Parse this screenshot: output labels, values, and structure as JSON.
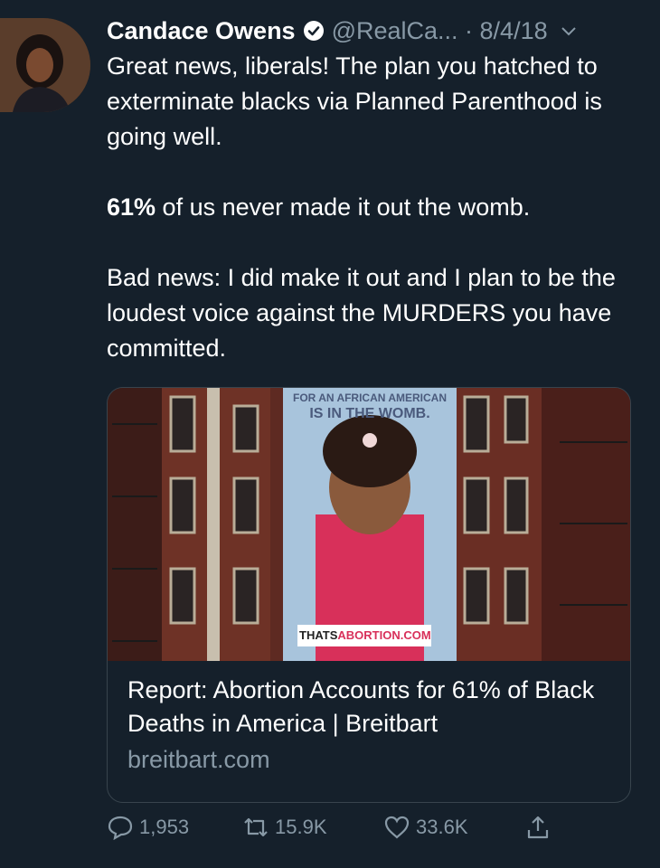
{
  "tweet": {
    "author_name": "Candace Owens",
    "handle_and_date": "@RealCa... · 8/4/18",
    "paragraphs": [
      "Great news, liberals! The plan you hatched to exterminate blacks via Planned Parenthood is going well.",
      "61% of us never made it out the womb.",
      "Bad news: I did make it out and I plan to be the loudest voice against the MURDERS you have committed."
    ],
    "para2_bold": "61%",
    "para2_rest": " of us never made it out the womb."
  },
  "card": {
    "billboard_line1": "FOR AN AFRICAN AMERICAN",
    "billboard_line2": "IS IN THE WOMB.",
    "billboard_site_a": "THATS",
    "billboard_site_b": "ABORTION.COM",
    "title": "Report: Abortion Accounts for 61% of Black Deaths in America | Breitbart",
    "domain": "breitbart.com"
  },
  "actions": {
    "replies": "1,953",
    "retweets": "15.9K",
    "likes": "33.6K"
  },
  "colors": {
    "background": "#15202b",
    "muted": "#8899a6",
    "border": "#38444d"
  },
  "icons": [
    "verified-icon",
    "chevron-down-icon",
    "reply-icon",
    "retweet-icon",
    "like-icon",
    "share-icon"
  ]
}
